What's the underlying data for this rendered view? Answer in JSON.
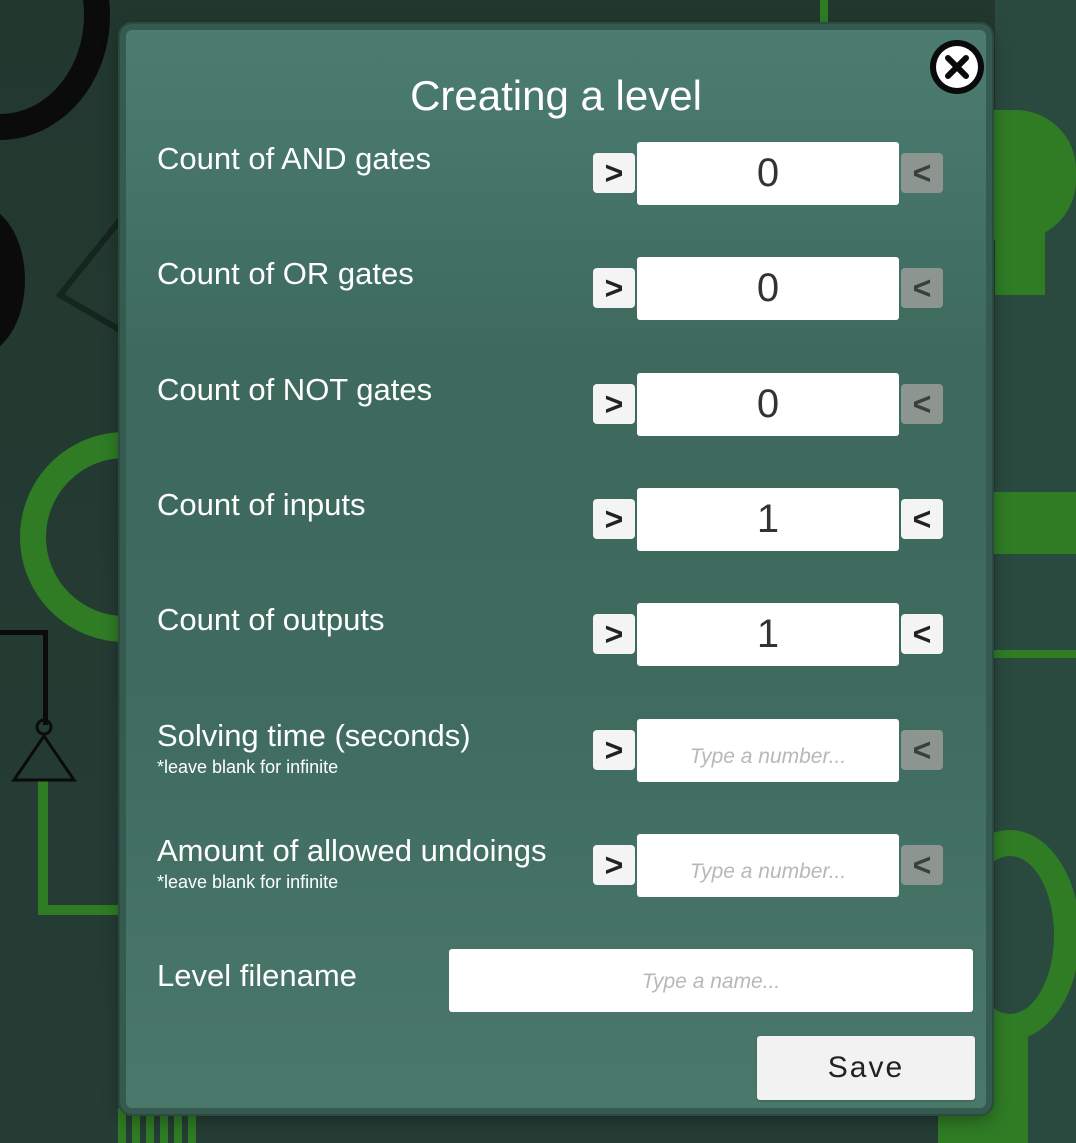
{
  "dialog": {
    "title": "Creating a level",
    "close_icon": "close-circle-icon"
  },
  "rows": [
    {
      "label": "Count of AND gates",
      "value": "0",
      "dec_label": ">",
      "inc_label": "<",
      "inc_enabled": false
    },
    {
      "label": "Count of OR gates",
      "value": "0",
      "dec_label": ">",
      "inc_label": "<",
      "inc_enabled": false
    },
    {
      "label": "Count of NOT gates",
      "value": "0",
      "dec_label": ">",
      "inc_label": "<",
      "inc_enabled": false
    },
    {
      "label": "Count of inputs",
      "value": "1",
      "dec_label": ">",
      "inc_label": "<",
      "inc_enabled": true
    },
    {
      "label": "Count of outputs",
      "value": "1",
      "dec_label": ">",
      "inc_label": "<",
      "inc_enabled": true
    },
    {
      "label": "Solving time (seconds)",
      "note": "*leave blank for infinite",
      "value": "",
      "placeholder": "Type a number...",
      "dec_label": ">",
      "inc_label": "<",
      "inc_enabled": false
    },
    {
      "label": "Amount of allowed undoings",
      "note": "*leave blank for infinite",
      "value": "",
      "placeholder": "Type a number...",
      "dec_label": ">",
      "inc_label": "<",
      "inc_enabled": false
    }
  ],
  "filename": {
    "label": "Level filename",
    "value": "",
    "placeholder": "Type a name..."
  },
  "save_label": "Save",
  "colors": {
    "dialog_bg": "#4c7c70",
    "wire_green": "#2f7c25",
    "disabled_button": "#8c9590"
  }
}
